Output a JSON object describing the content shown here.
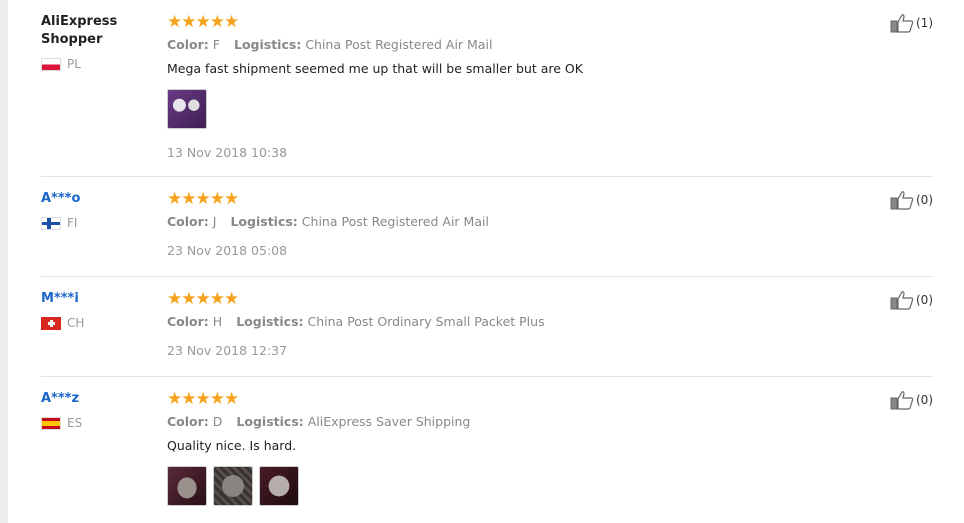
{
  "labels": {
    "color": "Color:",
    "logistics": "Logistics:"
  },
  "reviews": [
    {
      "user": "AliExpress Shopper",
      "country": "PL",
      "stars": "★★★★★",
      "color_value": "F",
      "logistics_value": "China Post Registered Air Mail",
      "feedback": "Mega fast shipment seemed me up that will be smaller but are OK",
      "photo_count": 1,
      "date": "13 Nov 2018 10:38",
      "likes": "(1)"
    },
    {
      "user": "A***o",
      "country": "FI",
      "stars": "★★★★★",
      "color_value": "J",
      "logistics_value": "China Post Registered Air Mail",
      "date": "23 Nov 2018 05:08",
      "likes": "(0)"
    },
    {
      "user": "M***i",
      "country": "CH",
      "stars": "★★★★★",
      "color_value": "H",
      "logistics_value": "China Post Ordinary Small Packet Plus",
      "date": "23 Nov 2018 12:37",
      "likes": "(0)"
    },
    {
      "user": "A***z",
      "country": "ES",
      "stars": "★★★★★",
      "color_value": "D",
      "logistics_value": "AliExpress Saver Shipping",
      "feedback": "Quality nice. Is hard.",
      "photo_count": 3,
      "likes": "(0)"
    }
  ],
  "colors": {
    "star": "#f7a21c",
    "masked_user": "#1a66c8",
    "meta": "#888888"
  },
  "icons": {
    "like": "thumbs-up-icon"
  }
}
